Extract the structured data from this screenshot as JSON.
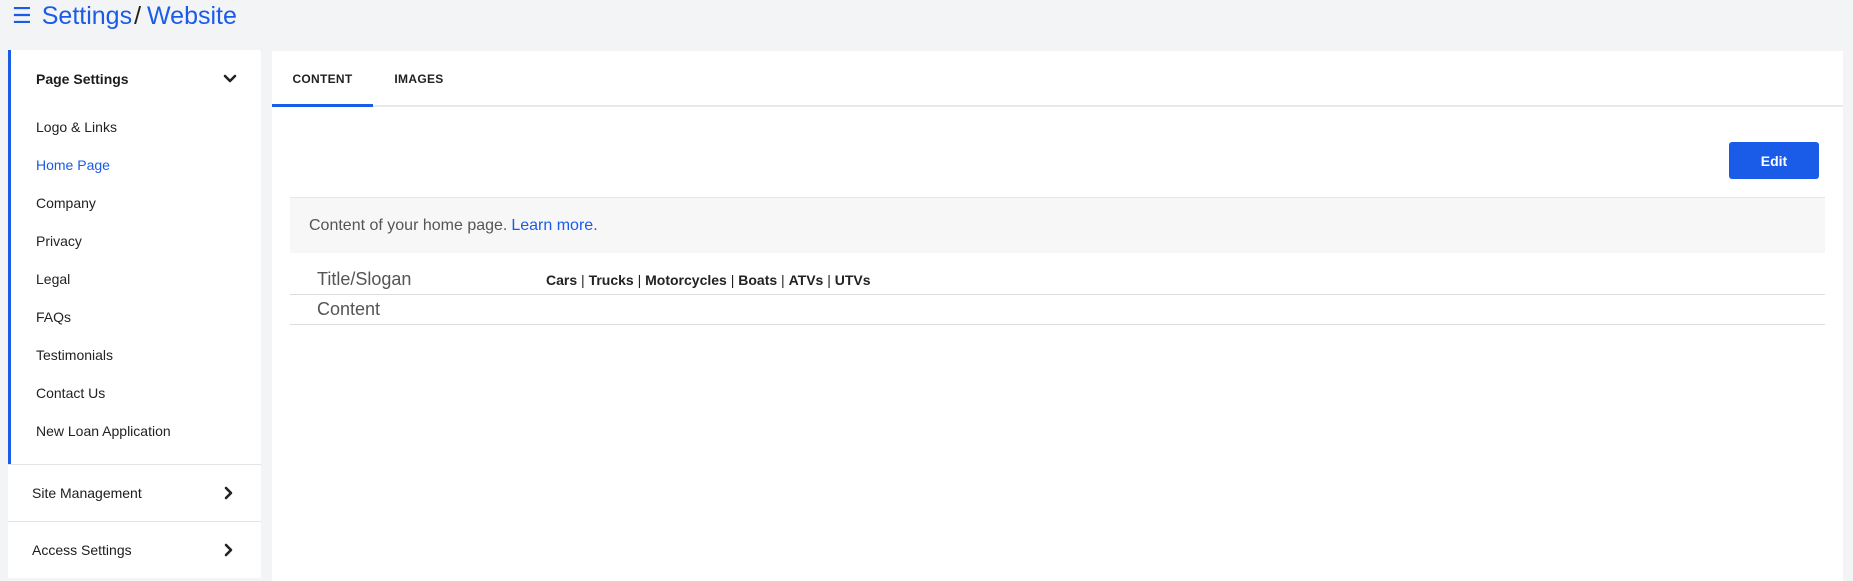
{
  "breadcrumb": {
    "menu_icon": "☰",
    "parent": "Settings",
    "separator": "/",
    "current": "Website"
  },
  "sidebar": {
    "open_section": {
      "title": "Page Settings",
      "items": [
        {
          "label": "Logo & Links",
          "active": false
        },
        {
          "label": "Home Page",
          "active": true
        },
        {
          "label": "Company",
          "active": false
        },
        {
          "label": "Privacy",
          "active": false
        },
        {
          "label": "Legal",
          "active": false
        },
        {
          "label": "FAQs",
          "active": false
        },
        {
          "label": "Testimonials",
          "active": false
        },
        {
          "label": "Contact Us",
          "active": false
        },
        {
          "label": "New Loan Application",
          "active": false
        }
      ]
    },
    "closed_sections": [
      {
        "title": "Site Management"
      },
      {
        "title": "Access Settings"
      }
    ]
  },
  "main": {
    "tabs": [
      {
        "label": "CONTENT",
        "active": true
      },
      {
        "label": "IMAGES",
        "active": false
      }
    ],
    "edit_label": "Edit",
    "info": {
      "text": "Content of your home page.",
      "link": "Learn more",
      "suffix": "."
    },
    "fields": [
      {
        "label": "Title/Slogan",
        "value": [
          "Cars",
          "Trucks",
          "Motorcycles",
          "Boats",
          "ATVs",
          "UTVs"
        ]
      },
      {
        "label": "Content",
        "value": []
      }
    ]
  },
  "colors": {
    "accent": "#1a5ce8",
    "background": "#f3f4f6",
    "panel": "#ffffff"
  }
}
